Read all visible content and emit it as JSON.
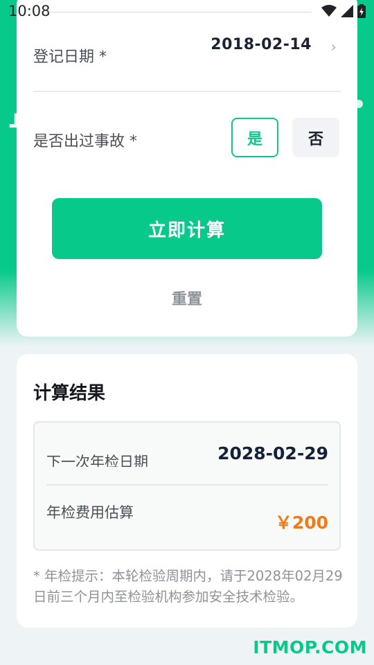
{
  "status_bar": {
    "time": "10:08"
  },
  "form": {
    "reg_date_label": "登记日期 *",
    "reg_date_value": "2018-02-14",
    "accident_label": "是否出过事故 *",
    "option_yes": "是",
    "option_no": "否",
    "selected_option": "是",
    "calculate_button": "立即计算",
    "reset_button": "重置"
  },
  "result": {
    "title": "计算结果",
    "next_inspection_label": "下一次年检日期",
    "next_inspection_date": "2028-02-29",
    "fee_label": "年检费用估算",
    "fee_value": "￥200",
    "tip": "* 年检提示：本轮检验周期内，请于2028年02月29日前三个月内至检验机构参加安全技术检验。"
  },
  "watermark": "ITMOP.COM",
  "colors": {
    "accent": "#07c98a",
    "fee": "#f07a1a"
  },
  "icons": [
    "wifi-icon",
    "signal-icon",
    "battery-icon",
    "chevron-right-icon"
  ]
}
